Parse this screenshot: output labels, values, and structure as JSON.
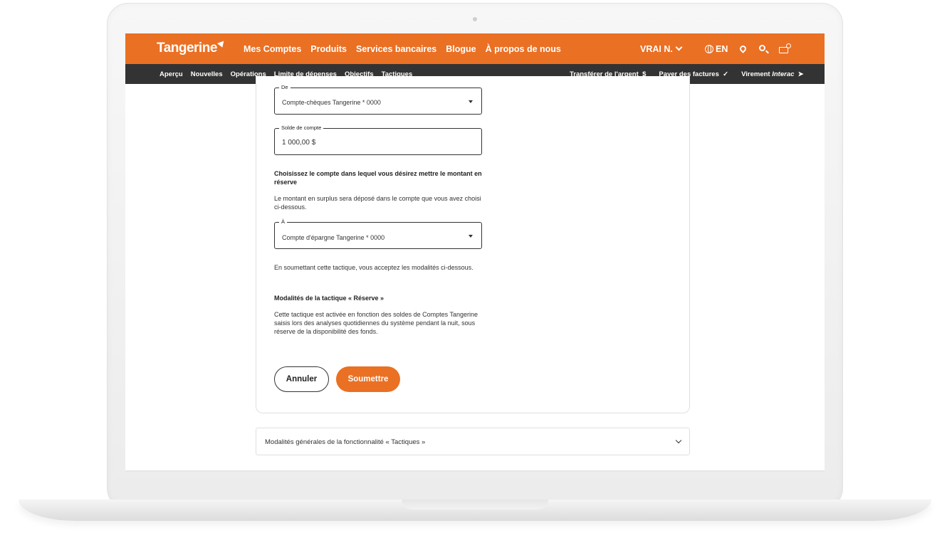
{
  "brand": {
    "logo_text": "Tangerine",
    "accent_color": "#ea7024",
    "subnav_color": "#333333"
  },
  "main_menu": [
    "Mes Comptes",
    "Produits",
    "Services bancaires",
    "Blogue",
    "À propos de nous"
  ],
  "user_menu": {
    "name": "VRAI N.",
    "language": "EN"
  },
  "icons": [
    "globe-icon",
    "location-pin-icon",
    "search-icon",
    "mail-icon"
  ],
  "subnav": {
    "items": [
      "Aperçu",
      "Nouvelles",
      "Opérations",
      "Limite de dépenses",
      "Objectifs",
      "Tactiques"
    ],
    "active": "Tactiques",
    "actions": {
      "transfer": "Transférer de l'argent",
      "transfer_icon": "$",
      "pay_bills": "Payer des factures",
      "pay_icon": "✓",
      "interac_prefix": "Virement",
      "interac_brand": "Interac",
      "interac_icon": "➤"
    }
  },
  "form": {
    "from_field": {
      "label": "De",
      "value": "Compte-chèques Tangerine * 0000"
    },
    "balance_field": {
      "label": "Solde de compte",
      "value": "1 000,00 $"
    },
    "choose_heading": "Choisissez le compte dans lequel vous désirez mettre le montant en réserve",
    "choose_desc": "Le montant en surplus sera déposé dans le compte que vous avez choisi ci-dessous.",
    "to_field": {
      "label": "À",
      "value": "Compte d'épargne Tangerine * 0000"
    },
    "accept_text": "En soumettant cette tactique, vous acceptez les modalités ci-dessous.",
    "terms_heading": "Modalités de la tactique « Réserve »",
    "terms_text": "Cette tactique est activée en fonction des soldes de Comptes Tangerine saisis lors des analyses quotidiennes du système pendant la nuit, sous réserve de la disponibilité des fonds.",
    "cancel_label": "Annuler",
    "submit_label": "Soumettre"
  },
  "accordion": {
    "label": "Modalités générales de la fonctionnalité « Tactiques »"
  }
}
